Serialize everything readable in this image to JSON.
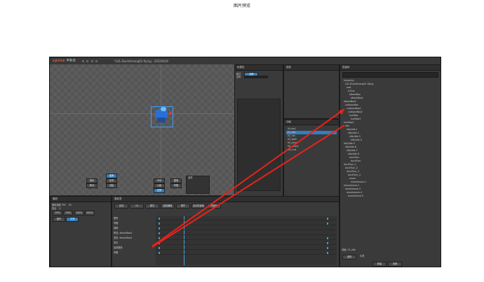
{
  "caption": "图片预览",
  "app": {
    "logo_main": "spine",
    "logo_sub": "PRO",
    "title": "*LOL-DuckAmong01-flying · 20220426"
  },
  "viewport": {
    "panels": {
      "tools_labels": [
        "姿势",
        "权重",
        "创建"
      ],
      "transform_labels": [
        "旋转",
        "移动",
        "缩放",
        "剪切"
      ],
      "axes_labels": [
        "本地",
        "父级",
        "世界"
      ],
      "compensate_labels": [
        "图像",
        "骨骼"
      ],
      "options_label": "选项"
    }
  },
  "tree_panel": {
    "title": "层级树",
    "search_placeholder": "",
    "items": [
      "hierarchy",
      "LOL-DuckAmong01-flying",
      "root",
      "d-Duo",
      "attackBox",
      "attackBox1",
      "attackBox2",
      "collisionBox",
      "collisionBox1",
      "collisionBox2",
      "hurtBox",
      "hurtBox1",
      "hurtBox2",
      "idle",
      "idle/idle-1",
      "idle/idle-2",
      "idle/idle-3",
      "idle/idle-4",
      "idle/idle-5",
      "idle/idle-6",
      "idle/idle-7",
      "idle/idle-8",
      "duckTurn",
      "duckTurn",
      "duckTurn_1",
      "duckTurn_2",
      "duckTurn_3",
      "duckTurn_4",
      "move",
      "move/move-1",
      "move/move-2",
      "move/move-3",
      "move/move-4",
      "move/move-5"
    ],
    "footer_label": "动画: 01_idle",
    "footer_select": "选择",
    "footer_check": "平滑",
    "footer_buttons": [
      "新建",
      "设置"
    ]
  },
  "props_panel": {
    "title": "树属性",
    "mode_label": "模式",
    "mode_value": "全部",
    "name_label": "名称"
  },
  "skins_panel": {
    "title": "皮肤"
  },
  "anim_panel": {
    "title": "动画",
    "items": [
      "00-leo1",
      "01_idle",
      "02_run",
      "03_walk",
      "04_jump",
      "05_attack",
      "06_hurt"
    ]
  },
  "play_panel": {
    "title": "播放",
    "speed_label": "播放速度 FPS",
    "speed_value": "30",
    "mix_label": "混合",
    "mix_value": "0",
    "buttons": [
      "25%",
      "50%",
      "100%",
      "200%"
    ],
    "checks": [
      "循环",
      "平滑"
    ]
  },
  "timeline": {
    "title": "摄影表",
    "toolbar": [
      "自动",
      "24",
      "模式",
      "曲线编辑",
      "循环",
      "自动关键帧",
      "关键帧"
    ],
    "rows": [
      "根骨",
      "骨骼",
      "插槽",
      "附加: attackBox2",
      "变形: attackBox2",
      "事件",
      "绘制顺序",
      "骨骼"
    ],
    "keyframes": [
      {
        "row": 0,
        "frames": [
          0,
          30
        ]
      },
      {
        "row": 1,
        "frames": [
          0,
          30
        ]
      },
      {
        "row": 2,
        "frames": [
          0
        ]
      },
      {
        "row": 3,
        "frames": [
          0
        ]
      },
      {
        "row": 4,
        "frames": [
          0,
          30
        ]
      },
      {
        "row": 5,
        "frames": [
          0,
          30
        ]
      },
      {
        "row": 6,
        "frames": [
          0,
          30
        ]
      },
      {
        "row": 7,
        "frames": [
          0,
          30
        ]
      }
    ]
  },
  "annotation": {
    "arrow_color": "#e8231a"
  }
}
